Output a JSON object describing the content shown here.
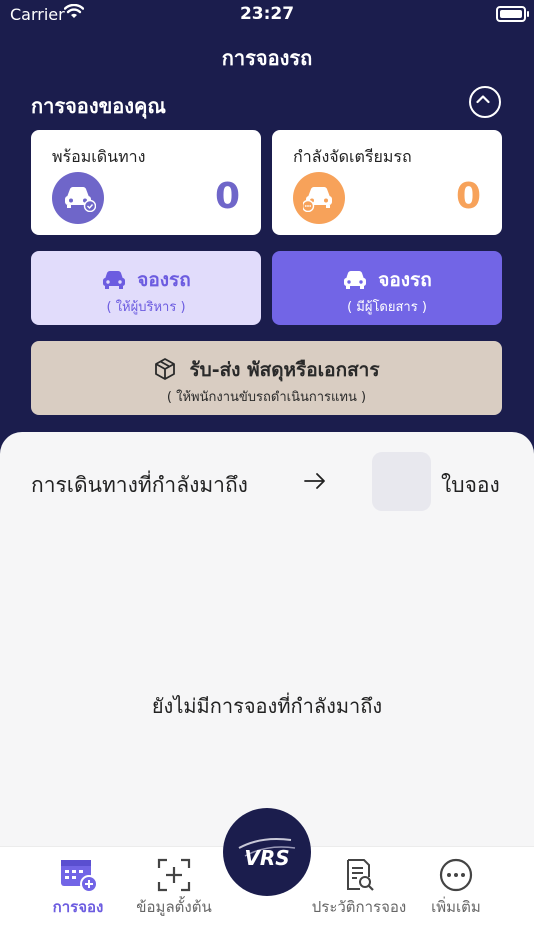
{
  "status_bar": {
    "carrier": "Carrier",
    "time": "23:27",
    "battery_level": 1.0
  },
  "header": {
    "title": "การจองรถ"
  },
  "bookings": {
    "title": "การจองของคุณ",
    "ready": {
      "label": "พร้อมเดินทาง",
      "count": "0",
      "color": "#6f66c9"
    },
    "preparing": {
      "label": "กำลังจัดเตรียมรถ",
      "count": "0",
      "color": "#f7a25a"
    }
  },
  "actions": {
    "book_admin": {
      "label": "จองรถ",
      "sub": "( ให้ผู้บริหาร )"
    },
    "book_passenger": {
      "label": "จองรถ",
      "sub": "( มีผู้โดยสาร )"
    },
    "parcel": {
      "label": "รับ-ส่ง พัสดุหรือเอกสาร",
      "sub": "( ให้พนักงานขับรถดำเนินการแทน )"
    }
  },
  "upcoming": {
    "title": "การเดินทางที่กำลังมาถึง",
    "unit": "ใบจอง",
    "empty_message": "ยังไม่มีการจองที่กำลังมาถึง"
  },
  "tabbar": {
    "items": [
      {
        "label": "การจอง",
        "icon": "calendar-plus-icon",
        "active": true
      },
      {
        "label": "ข้อมูลตั้งต้น",
        "icon": "scan-plus-icon",
        "active": false
      },
      {
        "label": "ประวัติการจอง",
        "icon": "document-search-icon",
        "active": false
      },
      {
        "label": "เพิ่มเติม",
        "icon": "more-icon",
        "active": false
      }
    ],
    "center_logo": "VRS"
  },
  "colors": {
    "navy": "#1b1d4d",
    "accent": "#6c5ce0",
    "light_accent": "#e1dcfb",
    "parcel": "#d9cdc2"
  }
}
